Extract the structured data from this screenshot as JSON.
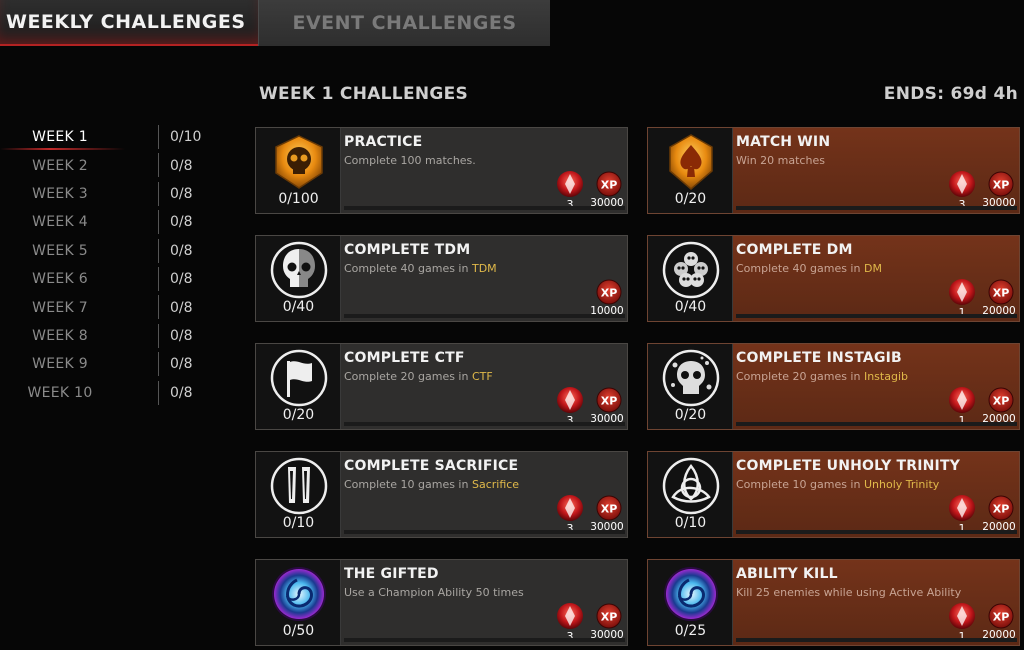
{
  "tabs": {
    "weekly": "WEEKLY CHALLENGES",
    "event": "EVENT CHALLENGES"
  },
  "heading": "WEEK 1 CHALLENGES",
  "ends": "ENDS: 69d 4h",
  "weeks": [
    {
      "label": "WEEK 1",
      "count": "0/10"
    },
    {
      "label": "WEEK 2",
      "count": "0/8"
    },
    {
      "label": "WEEK 3",
      "count": "0/8"
    },
    {
      "label": "WEEK 4",
      "count": "0/8"
    },
    {
      "label": "WEEK 5",
      "count": "0/8"
    },
    {
      "label": "WEEK 6",
      "count": "0/8"
    },
    {
      "label": "WEEK 7",
      "count": "0/8"
    },
    {
      "label": "WEEK 8",
      "count": "0/8"
    },
    {
      "label": "WEEK 9",
      "count": "0/8"
    },
    {
      "label": "WEEK 10",
      "count": "0/8"
    }
  ],
  "challenges": [
    {
      "title": "PRACTICE",
      "desc": "Complete 100 matches.",
      "hl": "",
      "progress": "0/100",
      "gems": "3",
      "xp_label": "XP",
      "xp": "30000",
      "icon": "skull-badge-icon"
    },
    {
      "title": "MATCH WIN",
      "desc": "Win 20 matches",
      "hl": "",
      "progress": "0/20",
      "gems": "3",
      "xp_label": "XP",
      "xp": "30000",
      "icon": "spade-badge-icon"
    },
    {
      "title": "COMPLETE TDM",
      "desc": "Complete 40 games in ",
      "hl": "TDM",
      "progress": "0/40",
      "gems": "",
      "xp_label": "XP",
      "xp": "10000",
      "icon": "half-skull-icon"
    },
    {
      "title": "COMPLETE DM",
      "desc": "Complete 40 games in ",
      "hl": "DM",
      "progress": "0/40",
      "gems": "1",
      "xp_label": "XP",
      "xp": "20000",
      "icon": "skull-pile-icon"
    },
    {
      "title": "COMPLETE CTF",
      "desc": "Complete 20 games in ",
      "hl": "CTF",
      "progress": "0/20",
      "gems": "3",
      "xp_label": "XP",
      "xp": "30000",
      "icon": "flag-icon"
    },
    {
      "title": "COMPLETE INSTAGIB",
      "desc": "Complete 20 games in ",
      "hl": "Instagib",
      "progress": "0/20",
      "gems": "1",
      "xp_label": "XP",
      "xp": "20000",
      "icon": "shattered-skull-icon"
    },
    {
      "title": "COMPLETE SACRIFICE",
      "desc": "Complete 10 games in ",
      "hl": "Sacrifice",
      "progress": "0/10",
      "gems": "3",
      "xp_label": "XP",
      "xp": "30000",
      "icon": "pillars-icon"
    },
    {
      "title": "COMPLETE UNHOLY TRINITY",
      "desc": "Complete 10 games in ",
      "hl": "Unholy Trinity",
      "progress": "0/10",
      "gems": "1",
      "xp_label": "XP",
      "xp": "20000",
      "icon": "triquetra-icon"
    },
    {
      "title": "THE GIFTED",
      "desc": "Use a Champion Ability 50 times",
      "hl": "",
      "progress": "0/50",
      "gems": "3",
      "xp_label": "XP",
      "xp": "30000",
      "icon": "vortex-icon"
    },
    {
      "title": "ABILITY KILL",
      "desc": "Kill 25 enemies while using Active Ability",
      "hl": "",
      "progress": "0/25",
      "gems": "1",
      "xp_label": "XP",
      "xp": "20000",
      "icon": "vortex-icon"
    }
  ]
}
